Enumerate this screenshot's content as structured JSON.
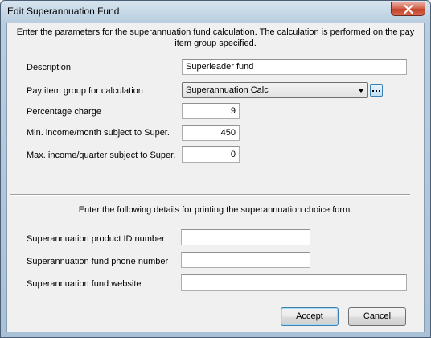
{
  "window": {
    "title": "Edit Superannuation Fund",
    "close_icon": "close-icon"
  },
  "section1": {
    "intro": "Enter the parameters for the superannuation fund calculation. The calculation is performed on the pay item group specified.",
    "description_label": "Description",
    "description_value": "Superleader fund",
    "pay_item_group_label": "Pay item group for calculation",
    "pay_item_group_value": "Superannuation Calc",
    "percentage_label": "Percentage charge",
    "percentage_value": "9",
    "min_income_label": "Min. income/month subject to Super.",
    "min_income_value": "450",
    "max_income_label": "Max. income/quarter subject to Super.",
    "max_income_value": "0"
  },
  "section2": {
    "intro": "Enter the following details for printing the superannuation choice form.",
    "product_id_label": "Superannuation product ID number",
    "product_id_value": "",
    "phone_label": "Superannuation fund phone number",
    "phone_value": "",
    "website_label": "Superannuation fund website",
    "website_value": ""
  },
  "buttons": {
    "accept": "Accept",
    "cancel": "Cancel"
  }
}
